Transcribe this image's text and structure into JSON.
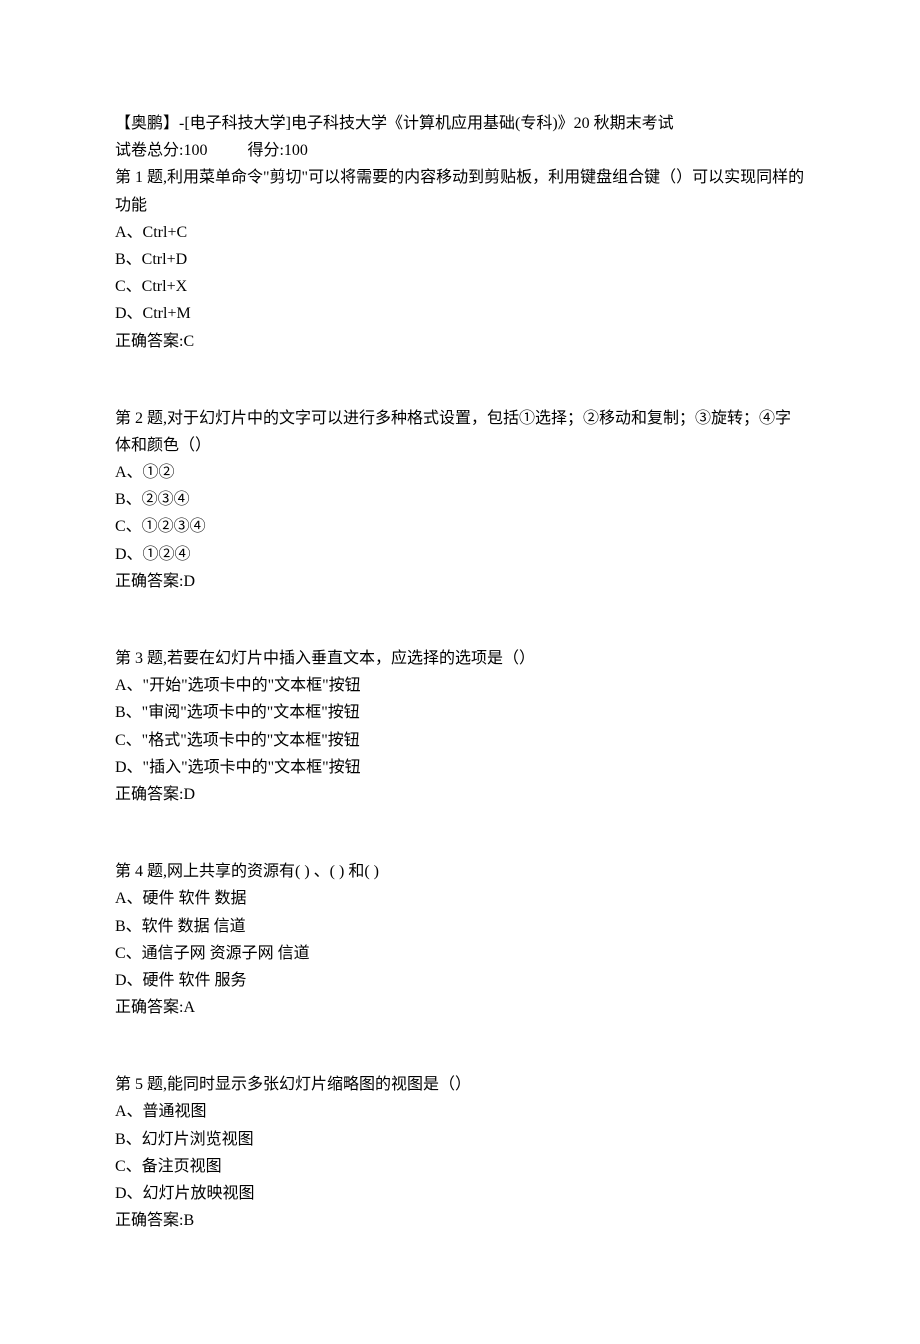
{
  "header": {
    "title": "【奥鹏】-[电子科技大学]电子科技大学《计算机应用基础(专科)》20 秋期末考试",
    "total_label": "试卷总分:100",
    "score_label": "得分:100"
  },
  "questions": [
    {
      "prompt": "第 1 题,利用菜单命令\"剪切\"可以将需要的内容移动到剪贴板，利用键盘组合键（）可以实现同样的功能",
      "options": [
        "A、Ctrl+C",
        "B、Ctrl+D",
        "C、Ctrl+X",
        "D、Ctrl+M"
      ],
      "answer": "正确答案:C"
    },
    {
      "prompt": "第 2 题,对于幻灯片中的文字可以进行多种格式设置，包括①选择；②移动和复制；③旋转；④字体和颜色（）",
      "options": [
        "A、①②",
        "B、②③④",
        "C、①②③④",
        "D、①②④"
      ],
      "answer": "正确答案:D"
    },
    {
      "prompt": "第 3 题,若要在幻灯片中插入垂直文本，应选择的选项是（）",
      "options": [
        "A、\"开始\"选项卡中的\"文本框\"按钮",
        "B、\"审阅\"选项卡中的\"文本框\"按钮",
        "C、\"格式\"选项卡中的\"文本框\"按钮",
        "D、\"插入\"选项卡中的\"文本框\"按钮"
      ],
      "answer": "正确答案:D"
    },
    {
      "prompt": "第 4 题,网上共享的资源有( ) 、( ) 和( )",
      "options": [
        "A、硬件 软件 数据",
        "B、软件 数据 信道",
        "C、通信子网 资源子网 信道",
        "D、硬件  软件  服务"
      ],
      "answer": "正确答案:A"
    },
    {
      "prompt": "第 5 题,能同时显示多张幻灯片缩略图的视图是（）",
      "options": [
        "A、普通视图",
        "B、幻灯片浏览视图",
        "C、备注页视图",
        "D、幻灯片放映视图"
      ],
      "answer": "正确答案:B"
    }
  ]
}
